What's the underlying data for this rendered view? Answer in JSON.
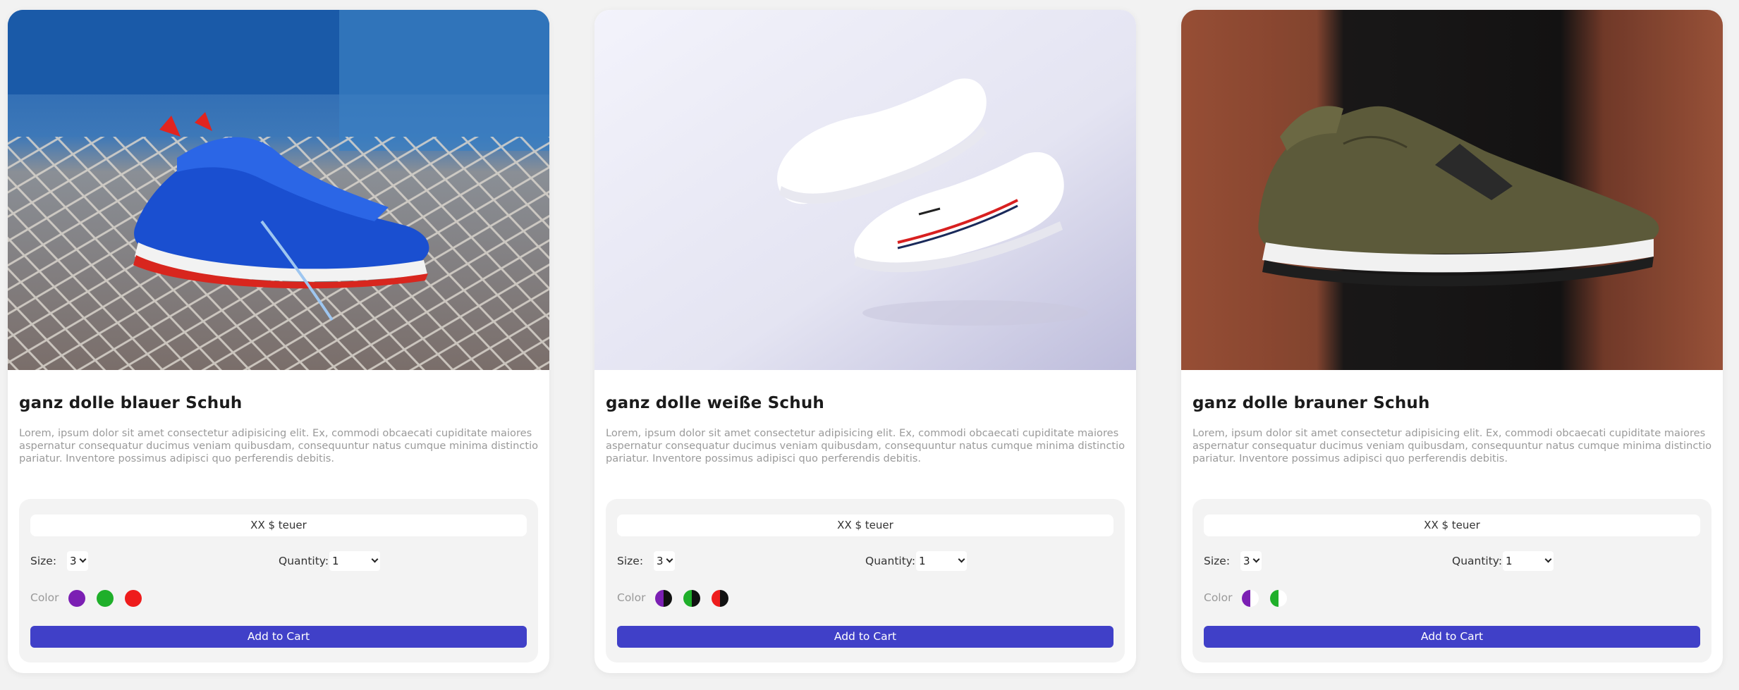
{
  "products": [
    {
      "title": "ganz dolle blauer Schuh",
      "description": "Lorem, ipsum dolor sit amet consectetur adipisicing elit. Ex, commodi obcaecati cupiditate maiores aspernatur consequatur ducimus veniam quibusdam, consequuntur natus cumque minima distinctio pariatur. Inventore possimus adipisci quo perferendis debitis.",
      "price": "XX $ teuer",
      "size_label": "Size:",
      "size_value": "3",
      "quantity_label": "Quantity:",
      "quantity_value": "1",
      "color_label": "Color",
      "colors": [
        "#7b1fb3",
        "#1faf2a",
        "#ee1c1c"
      ],
      "add_to_cart": "Add to Cart",
      "image": "blue-sneaker-photo"
    },
    {
      "title": "ganz dolle weiße Schuh",
      "description": "Lorem, ipsum dolor sit amet consectetur adipisicing elit. Ex, commodi obcaecati cupiditate maiores aspernatur consequatur ducimus veniam quibusdam, consequuntur natus cumque minima distinctio pariatur. Inventore possimus adipisci quo perferendis debitis.",
      "price": "XX $ teuer",
      "size_label": "Size:",
      "size_value": "3",
      "quantity_label": "Quantity:",
      "quantity_value": "1",
      "color_label": "Color",
      "colors": [
        "#7b1fb3",
        "#1faf2a",
        "#ee1c1c"
      ],
      "add_to_cart": "Add to Cart",
      "image": "white-sneaker-photo"
    },
    {
      "title": "ganz dolle brauner Schuh",
      "description": "Lorem, ipsum dolor sit amet consectetur adipisicing elit. Ex, commodi obcaecati cupiditate maiores aspernatur consequatur ducimus veniam quibusdam, consequuntur natus cumque minima distinctio pariatur. Inventore possimus adipisci quo perferendis debitis.",
      "price": "XX $ teuer",
      "size_label": "Size:",
      "size_value": "3",
      "quantity_label": "Quantity:",
      "quantity_value": "1",
      "color_label": "Color",
      "colors": [
        "#7b1fb3",
        "#1faf2a"
      ],
      "add_to_cart": "Add to Cart",
      "image": "olive-sneaker-photo"
    }
  ],
  "colors": {
    "page_background": "#f2f2f2",
    "card_background": "#ffffff",
    "panel_background": "#f3f3f3",
    "button_accent": "#4040c8"
  }
}
